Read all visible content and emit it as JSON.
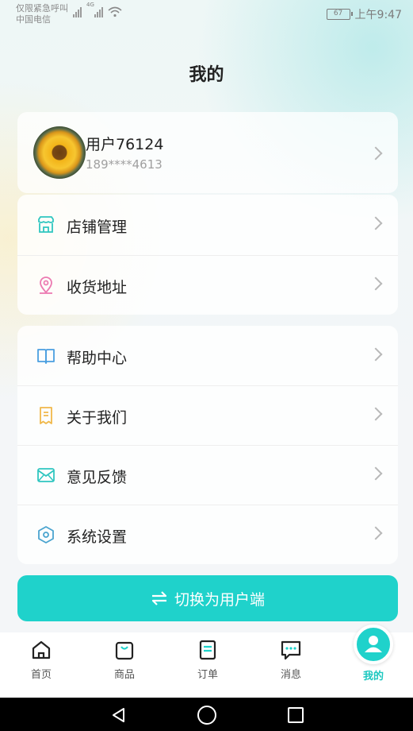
{
  "status_bar": {
    "carrier_line1": "仅限紧急呼叫",
    "carrier_line2": "中国电信",
    "network": "4G",
    "battery": "67",
    "time": "上午9:47"
  },
  "page": {
    "title": "我的"
  },
  "profile": {
    "username": "用户76124",
    "phone": "189****4613"
  },
  "menu_group_1": [
    {
      "label": "店铺管理",
      "icon": "store-icon",
      "color": "#2fc6c0"
    },
    {
      "label": "收货地址",
      "icon": "location-pin-icon",
      "color": "#ec7bb2"
    }
  ],
  "menu_group_2": [
    {
      "label": "帮助中心",
      "icon": "book-icon",
      "color": "#4a9fe0"
    },
    {
      "label": "关于我们",
      "icon": "receipt-icon",
      "color": "#f0b84a"
    },
    {
      "label": "意见反馈",
      "icon": "mail-icon",
      "color": "#2fc6c0"
    },
    {
      "label": "系统设置",
      "icon": "settings-hexagon-icon",
      "color": "#4aa4cf"
    }
  ],
  "switch_button": {
    "label": "切换为用户端",
    "icon": "swap-arrows-icon"
  },
  "tabbar": {
    "items": [
      {
        "label": "首页",
        "icon": "home-icon"
      },
      {
        "label": "商品",
        "icon": "shopping-bag-icon"
      },
      {
        "label": "订单",
        "icon": "order-list-icon"
      },
      {
        "label": "消息",
        "icon": "chat-bubble-icon"
      },
      {
        "label": "我的",
        "icon": "user-icon",
        "active": true
      }
    ]
  },
  "colors": {
    "accent": "#1fd2cb",
    "text": "#222222",
    "muted": "#a0a0a0"
  }
}
